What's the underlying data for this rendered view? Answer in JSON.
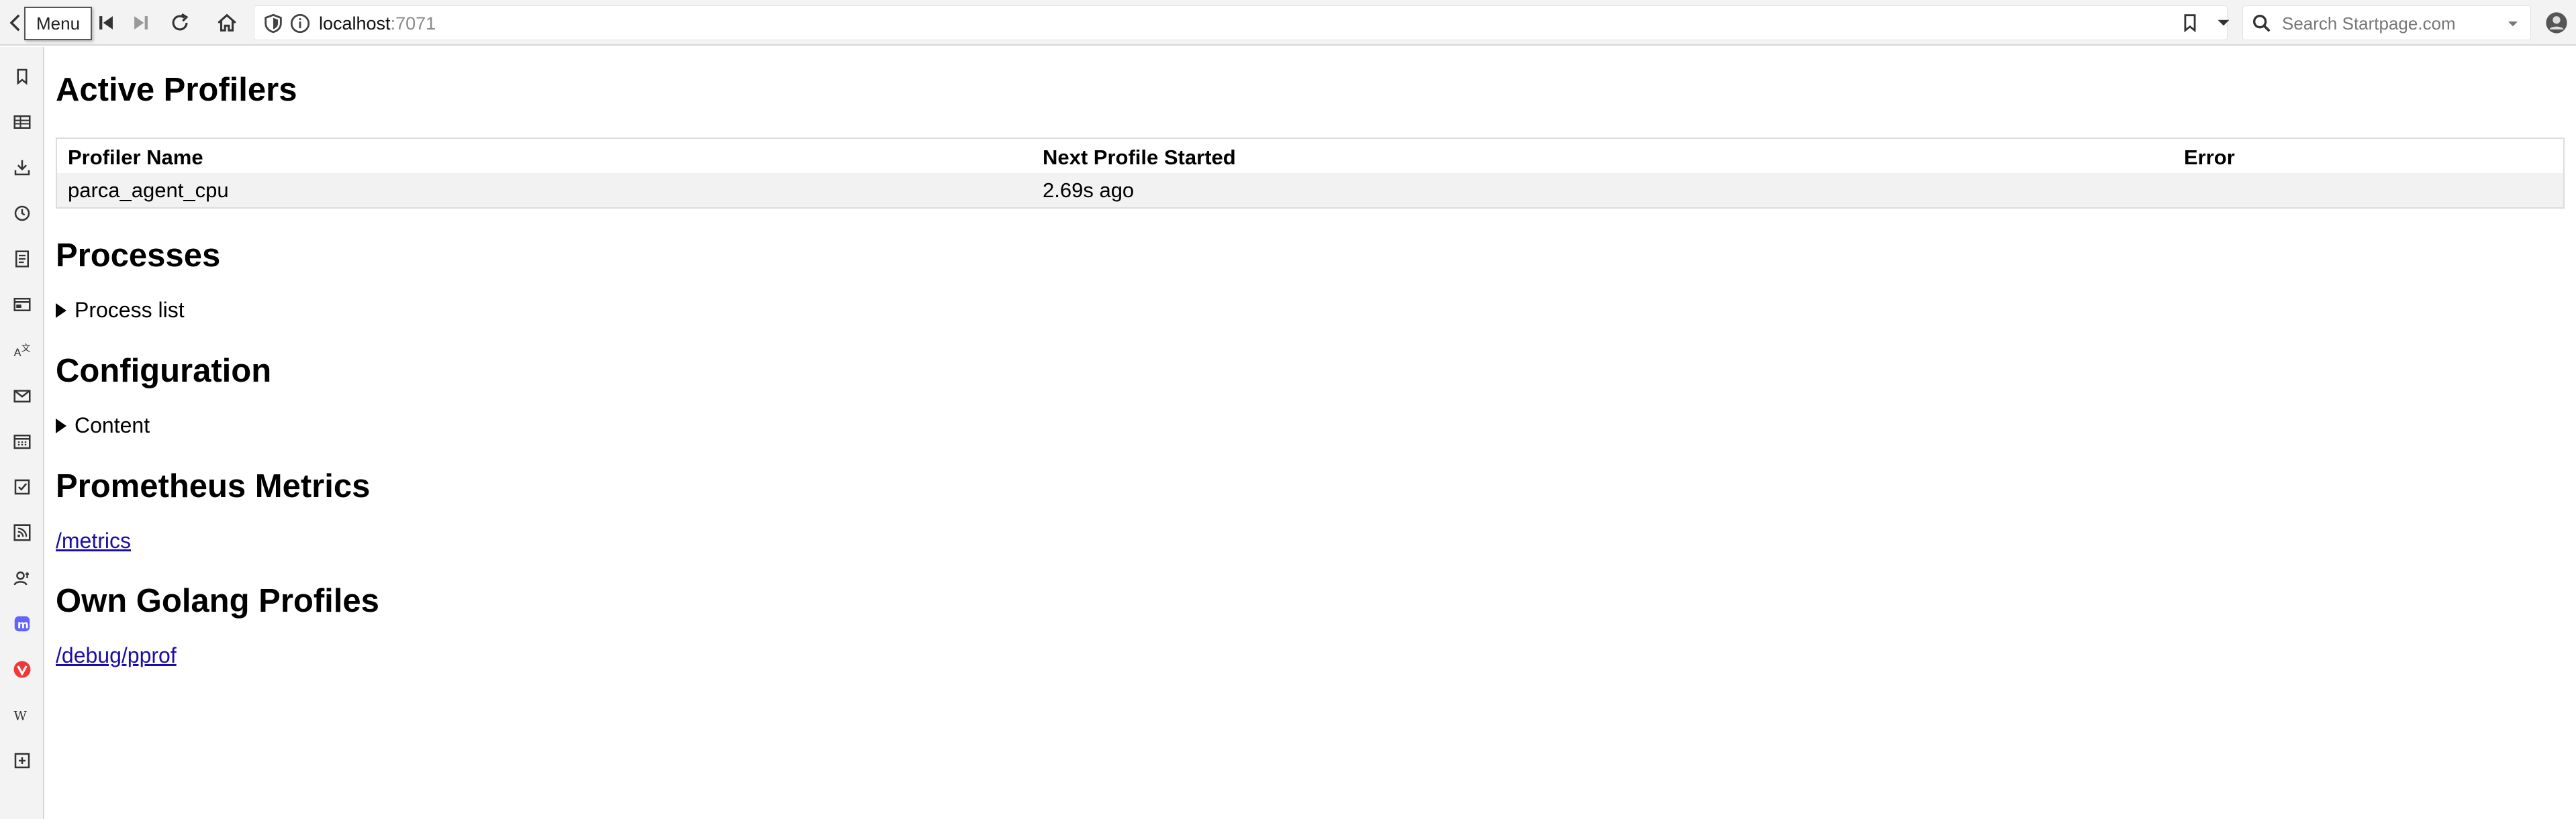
{
  "browser": {
    "menu_tooltip": "Menu",
    "url_host": "localhost",
    "url_port": ":7071",
    "search_placeholder": "Search Startpage.com",
    "icons": [
      "back-icon",
      "skip-back-icon",
      "skip-forward-icon",
      "reload-icon",
      "home-icon",
      "shield-icon",
      "info-icon",
      "bookmark-icon",
      "chevron-down-icon",
      "search-icon",
      "avatar-icon"
    ]
  },
  "sidebar": {
    "icons": [
      "bookmarks-icon",
      "reading-list-icon",
      "downloads-icon",
      "history-icon",
      "notes-icon",
      "window-panel-icon",
      "translate-icon",
      "mail-icon",
      "calendar-icon",
      "tasks-icon",
      "feeds-icon",
      "contacts-icon",
      "mastodon-icon",
      "vivaldi-icon",
      "wikipedia-icon",
      "add-panel-icon"
    ]
  },
  "page": {
    "active_profilers": {
      "heading": "Active Profilers",
      "columns": [
        "Profiler Name",
        "Next Profile Started",
        "Error"
      ],
      "rows": [
        [
          "parca_agent_cpu",
          "2.69s ago",
          ""
        ]
      ]
    },
    "processes": {
      "heading": "Processes",
      "summary": "Process list"
    },
    "configuration": {
      "heading": "Configuration",
      "summary": "Content"
    },
    "prometheus": {
      "heading": "Prometheus Metrics",
      "link": "/metrics"
    },
    "golang": {
      "heading": "Own Golang Profiles",
      "link": "/debug/pprof"
    }
  },
  "colors": {
    "link": "#1a0dab",
    "mastodon": "#6364ff",
    "vivaldi": "#ef3939",
    "toolbar_bg": "#f3f3f3"
  }
}
